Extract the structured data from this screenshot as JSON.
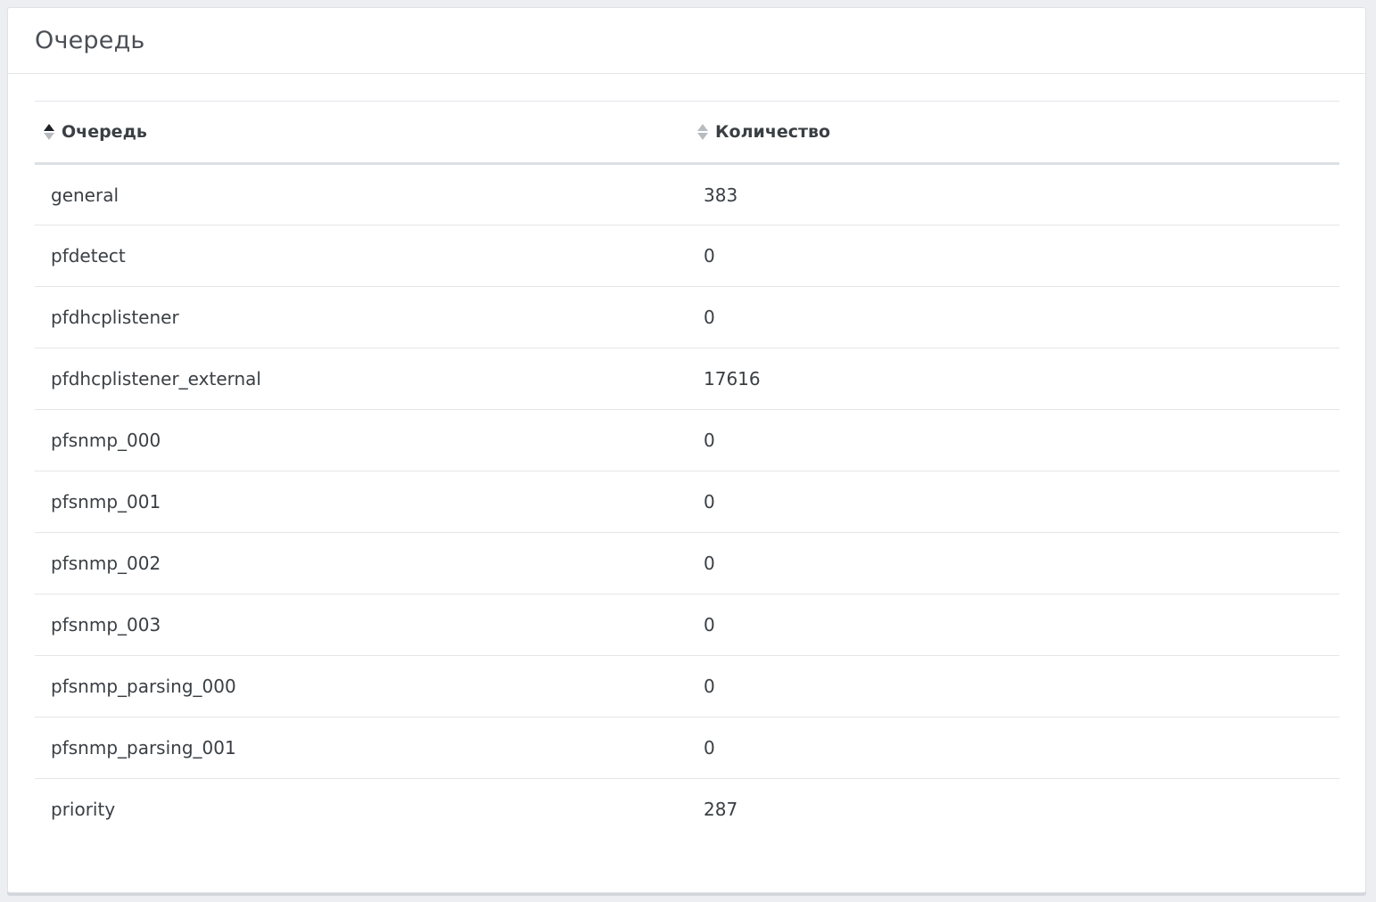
{
  "panel": {
    "title": "Очередь"
  },
  "table": {
    "columns": [
      {
        "label": "Очередь",
        "sort": "ascending"
      },
      {
        "label": "Количество",
        "sort": "none"
      }
    ],
    "rows": [
      {
        "queue": "general",
        "count": "383"
      },
      {
        "queue": "pfdetect",
        "count": "0"
      },
      {
        "queue": "pfdhcplistener",
        "count": "0"
      },
      {
        "queue": "pfdhcplistener_external",
        "count": "17616"
      },
      {
        "queue": "pfsnmp_000",
        "count": "0"
      },
      {
        "queue": "pfsnmp_001",
        "count": "0"
      },
      {
        "queue": "pfsnmp_002",
        "count": "0"
      },
      {
        "queue": "pfsnmp_003",
        "count": "0"
      },
      {
        "queue": "pfsnmp_parsing_000",
        "count": "0"
      },
      {
        "queue": "pfsnmp_parsing_001",
        "count": "0"
      },
      {
        "queue": "priority",
        "count": "287"
      }
    ]
  },
  "icons": {
    "sort_asc": "sort-ascending-icon",
    "sort_none": "sort-icon"
  }
}
